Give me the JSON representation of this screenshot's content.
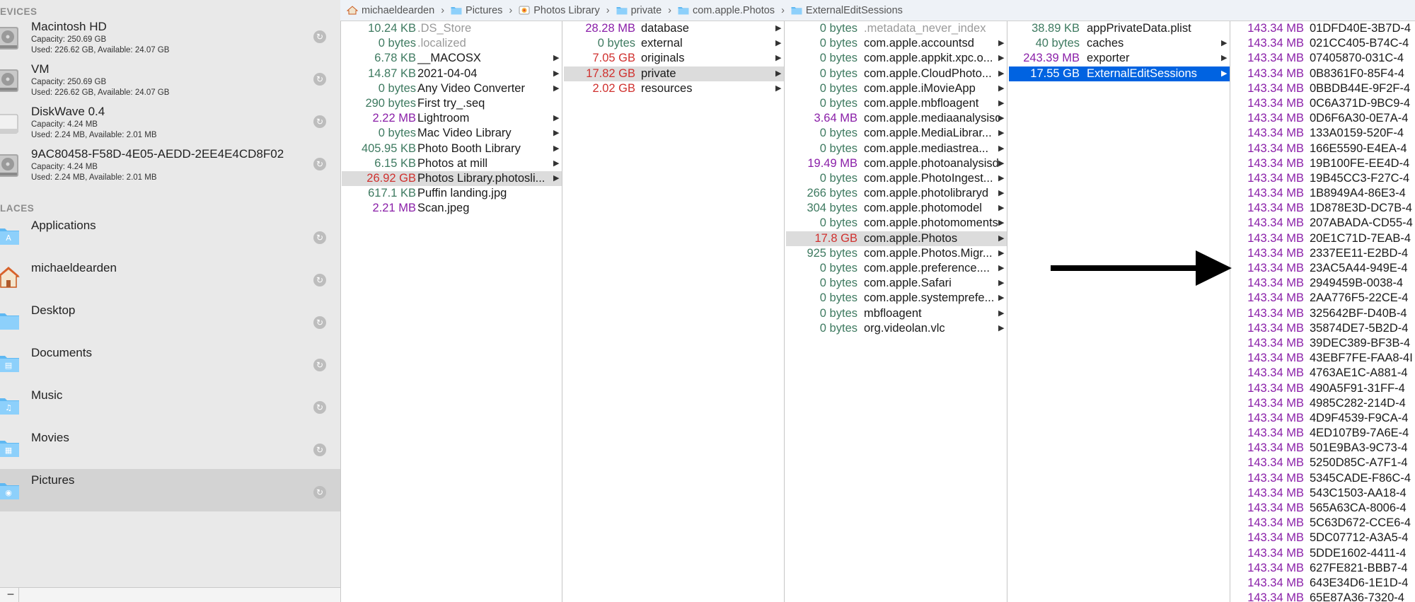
{
  "sidebar": {
    "devices_heading": "EVICES",
    "places_heading": "LACES",
    "devices": [
      {
        "name": "Macintosh HD",
        "capacity": "Capacity: 250.69 GB",
        "used": "Used: 226.62 GB, Available: 24.07 GB",
        "icon": "hard-drive-icon"
      },
      {
        "name": "VM",
        "capacity": "Capacity: 250.69 GB",
        "used": "Used: 226.62 GB, Available: 24.07 GB",
        "icon": "hard-drive-icon"
      },
      {
        "name": "DiskWave 0.4",
        "capacity": "Capacity: 4.24 MB",
        "used": "Used: 2.24 MB, Available: 2.01 MB",
        "icon": "disk-image-icon"
      },
      {
        "name": "9AC80458-F58D-4E05-AEDD-2EE4E4CD8F02",
        "capacity": "Capacity: 4.24 MB",
        "used": "Used: 2.24 MB, Available: 2.01 MB",
        "icon": "hard-drive-icon"
      }
    ],
    "places": [
      {
        "name": "Applications",
        "icon": "applications-folder-icon"
      },
      {
        "name": "michaeldearden",
        "icon": "home-icon"
      },
      {
        "name": "Desktop",
        "icon": "desktop-folder-icon"
      },
      {
        "name": "Documents",
        "icon": "documents-folder-icon"
      },
      {
        "name": "Music",
        "icon": "music-folder-icon"
      },
      {
        "name": "Movies",
        "icon": "movies-folder-icon"
      },
      {
        "name": "Pictures",
        "icon": "pictures-folder-icon"
      }
    ],
    "refresh_glyph": "↻",
    "minus_label": "−"
  },
  "pathbar": {
    "crumbs": [
      "michaeldearden",
      "Pictures",
      "Photos Library",
      "private",
      "com.apple.Photos",
      "ExternalEditSessions"
    ],
    "separator": "›"
  },
  "columns": {
    "col1": [
      {
        "size": "10.24 KB",
        "name": ".DS_Store",
        "tone": "k",
        "dim": true
      },
      {
        "size": "0 bytes",
        "name": ".localized",
        "tone": "b",
        "dim": true
      },
      {
        "size": "6.78 KB",
        "name": "__MACOSX",
        "tone": "k",
        "folder": true
      },
      {
        "size": "14.87 KB",
        "name": "2021-04-04",
        "tone": "k",
        "folder": true
      },
      {
        "size": "0 bytes",
        "name": "Any Video Converter",
        "tone": "b",
        "folder": true
      },
      {
        "size": "290 bytes",
        "name": "First try_.seq",
        "tone": "b"
      },
      {
        "size": "2.22 MB",
        "name": "Lightroom",
        "tone": "m",
        "folder": true
      },
      {
        "size": "0 bytes",
        "name": "Mac Video Library",
        "tone": "b",
        "folder": true
      },
      {
        "size": "405.95 KB",
        "name": "Photo Booth Library",
        "tone": "k",
        "folder": true
      },
      {
        "size": "6.15 KB",
        "name": "Photos at mill",
        "tone": "k",
        "folder": true
      },
      {
        "size": "26.92 GB",
        "name": "Photos Library.photosli...",
        "tone": "g",
        "folder": true,
        "hl": true
      },
      {
        "size": "617.1 KB",
        "name": "Puffin landing.jpg",
        "tone": "k"
      },
      {
        "size": "2.21 MB",
        "name": "Scan.jpeg",
        "tone": "m"
      }
    ],
    "col2": [
      {
        "size": "28.28 MB",
        "name": "database",
        "tone": "m",
        "folder": true
      },
      {
        "size": "0 bytes",
        "name": "external",
        "tone": "b",
        "folder": true
      },
      {
        "size": "7.05 GB",
        "name": "originals",
        "tone": "g",
        "folder": true
      },
      {
        "size": "17.82 GB",
        "name": "private",
        "tone": "g",
        "folder": true,
        "hl": true
      },
      {
        "size": "2.02 GB",
        "name": "resources",
        "tone": "g",
        "folder": true
      }
    ],
    "col3": [
      {
        "size": "0 bytes",
        "name": ".metadata_never_index",
        "tone": "b",
        "dim": true
      },
      {
        "size": "0 bytes",
        "name": "com.apple.accountsd",
        "tone": "b",
        "folder": true
      },
      {
        "size": "0 bytes",
        "name": "com.apple.appkit.xpc.o...",
        "tone": "b",
        "folder": true
      },
      {
        "size": "0 bytes",
        "name": "com.apple.CloudPhoto...",
        "tone": "b",
        "folder": true
      },
      {
        "size": "0 bytes",
        "name": "com.apple.iMovieApp",
        "tone": "b",
        "folder": true
      },
      {
        "size": "0 bytes",
        "name": "com.apple.mbfloagent",
        "tone": "b",
        "folder": true
      },
      {
        "size": "3.64 MB",
        "name": "com.apple.mediaanalysisd",
        "tone": "m",
        "folder": true
      },
      {
        "size": "0 bytes",
        "name": "com.apple.MediaLibrar...",
        "tone": "b",
        "folder": true
      },
      {
        "size": "0 bytes",
        "name": "com.apple.mediastrea...",
        "tone": "b",
        "folder": true
      },
      {
        "size": "19.49 MB",
        "name": "com.apple.photoanalysisd",
        "tone": "m",
        "folder": true
      },
      {
        "size": "0 bytes",
        "name": "com.apple.PhotoIngest...",
        "tone": "b",
        "folder": true
      },
      {
        "size": "266 bytes",
        "name": "com.apple.photolibraryd",
        "tone": "b",
        "folder": true
      },
      {
        "size": "304 bytes",
        "name": "com.apple.photomodel",
        "tone": "b",
        "folder": true
      },
      {
        "size": "0 bytes",
        "name": "com.apple.photomoments",
        "tone": "b",
        "folder": true
      },
      {
        "size": "17.8 GB",
        "name": "com.apple.Photos",
        "tone": "g",
        "folder": true,
        "hl": true
      },
      {
        "size": "925 bytes",
        "name": "com.apple.Photos.Migr...",
        "tone": "b",
        "folder": true
      },
      {
        "size": "0 bytes",
        "name": "com.apple.preference....",
        "tone": "b",
        "folder": true
      },
      {
        "size": "0 bytes",
        "name": "com.apple.Safari",
        "tone": "b",
        "folder": true
      },
      {
        "size": "0 bytes",
        "name": "com.apple.systemprefe...",
        "tone": "b",
        "folder": true
      },
      {
        "size": "0 bytes",
        "name": "mbfloagent",
        "tone": "b",
        "folder": true
      },
      {
        "size": "0 bytes",
        "name": "org.videolan.vlc",
        "tone": "b",
        "folder": true
      }
    ],
    "col4": [
      {
        "size": "38.89 KB",
        "name": "appPrivateData.plist",
        "tone": "k"
      },
      {
        "size": "40 bytes",
        "name": "caches",
        "tone": "b",
        "folder": true
      },
      {
        "size": "243.39 MB",
        "name": "exporter",
        "tone": "m",
        "folder": true
      },
      {
        "size": "17.55 GB",
        "name": "ExternalEditSessions",
        "tone": "g",
        "folder": true,
        "sel": true
      }
    ],
    "col5": [
      {
        "size": "143.34 MB",
        "name": "01DFD40E-3B7D-4",
        "tone": "m"
      },
      {
        "size": "143.34 MB",
        "name": "021CC405-B74C-4",
        "tone": "m"
      },
      {
        "size": "143.34 MB",
        "name": "07405870-031C-4",
        "tone": "m"
      },
      {
        "size": "143.34 MB",
        "name": "0B8361F0-85F4-4",
        "tone": "m"
      },
      {
        "size": "143.34 MB",
        "name": "0BBDB44E-9F2F-4",
        "tone": "m"
      },
      {
        "size": "143.34 MB",
        "name": "0C6A371D-9BC9-4",
        "tone": "m"
      },
      {
        "size": "143.34 MB",
        "name": "0D6F6A30-0E7A-4",
        "tone": "m"
      },
      {
        "size": "143.34 MB",
        "name": "133A0159-520F-4",
        "tone": "m"
      },
      {
        "size": "143.34 MB",
        "name": "166E5590-E4EA-4",
        "tone": "m"
      },
      {
        "size": "143.34 MB",
        "name": "19B100FE-EE4D-4",
        "tone": "m"
      },
      {
        "size": "143.34 MB",
        "name": "19B45CC3-F27C-4",
        "tone": "m"
      },
      {
        "size": "143.34 MB",
        "name": "1B8949A4-86E3-4",
        "tone": "m"
      },
      {
        "size": "143.34 MB",
        "name": "1D878E3D-DC7B-4",
        "tone": "m"
      },
      {
        "size": "143.34 MB",
        "name": "207ABADA-CD55-4",
        "tone": "m"
      },
      {
        "size": "143.34 MB",
        "name": "20E1C71D-7EAB-4",
        "tone": "m"
      },
      {
        "size": "143.34 MB",
        "name": "2337EE11-E2BD-4",
        "tone": "m"
      },
      {
        "size": "143.34 MB",
        "name": "23AC5A44-949E-4",
        "tone": "m"
      },
      {
        "size": "143.34 MB",
        "name": "2949459B-0038-4",
        "tone": "m"
      },
      {
        "size": "143.34 MB",
        "name": "2AA776F5-22CE-4",
        "tone": "m"
      },
      {
        "size": "143.34 MB",
        "name": "325642BF-D40B-4",
        "tone": "m"
      },
      {
        "size": "143.34 MB",
        "name": "35874DE7-5B2D-4",
        "tone": "m"
      },
      {
        "size": "143.34 MB",
        "name": "39DEC389-BF3B-4",
        "tone": "m"
      },
      {
        "size": "143.34 MB",
        "name": "43EBF7FE-FAA8-4I",
        "tone": "m"
      },
      {
        "size": "143.34 MB",
        "name": "4763AE1C-A881-4",
        "tone": "m"
      },
      {
        "size": "143.34 MB",
        "name": "490A5F91-31FF-4",
        "tone": "m"
      },
      {
        "size": "143.34 MB",
        "name": "4985C282-214D-4",
        "tone": "m"
      },
      {
        "size": "143.34 MB",
        "name": "4D9F4539-F9CA-4",
        "tone": "m"
      },
      {
        "size": "143.34 MB",
        "name": "4ED107B9-7A6E-4",
        "tone": "m"
      },
      {
        "size": "143.34 MB",
        "name": "501E9BA3-9C73-4",
        "tone": "m"
      },
      {
        "size": "143.34 MB",
        "name": "5250D85C-A7F1-4",
        "tone": "m"
      },
      {
        "size": "143.34 MB",
        "name": "5345CADE-F86C-4",
        "tone": "m"
      },
      {
        "size": "143.34 MB",
        "name": "543C1503-AA18-4",
        "tone": "m"
      },
      {
        "size": "143.34 MB",
        "name": "565A63CA-8006-4",
        "tone": "m"
      },
      {
        "size": "143.34 MB",
        "name": "5C63D672-CCE6-4",
        "tone": "m"
      },
      {
        "size": "143.34 MB",
        "name": "5DC07712-A3A5-4",
        "tone": "m"
      },
      {
        "size": "143.34 MB",
        "name": "5DDE1602-4411-4",
        "tone": "m"
      },
      {
        "size": "143.34 MB",
        "name": "627FE821-BBB7-4",
        "tone": "m"
      },
      {
        "size": "143.34 MB",
        "name": "643E34D6-1E1D-4",
        "tone": "m"
      },
      {
        "size": "143.34 MB",
        "name": "65E87A36-7320-4",
        "tone": "m"
      }
    ]
  },
  "colors": {
    "selection": "#0063e1",
    "size_small": "#3e7a60",
    "size_mb": "#8a1fa8",
    "size_gb": "#d0312f"
  }
}
